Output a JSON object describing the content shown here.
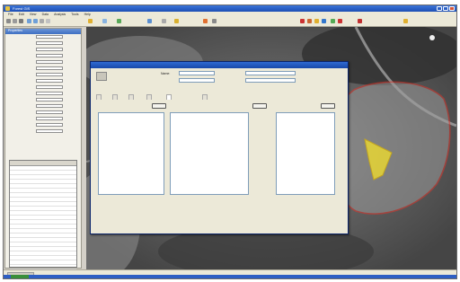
{
  "app": {
    "title": "Forest GIS",
    "menu": [
      "File",
      "Edit",
      "View",
      "Data",
      "Analysis",
      "Tools",
      "Help"
    ]
  },
  "left_panel": {
    "title": "Properties",
    "fields": [
      "",
      "",
      "",
      "",
      "",
      "",
      "",
      "",
      "",
      "",
      "",
      "",
      "",
      "",
      "",
      ""
    ]
  },
  "dialog": {
    "title": "",
    "name_label": "Name:",
    "name_value": "",
    "tabs": [
      "",
      "",
      "",
      "",
      "",
      ""
    ],
    "left_pane_title": "",
    "mid_pane_title": "",
    "right_pane_title": ""
  },
  "colors": {
    "titlebar": "#1d4fb5",
    "stand_outline": "#e0352b",
    "selected_stand": "#f5e12a"
  }
}
